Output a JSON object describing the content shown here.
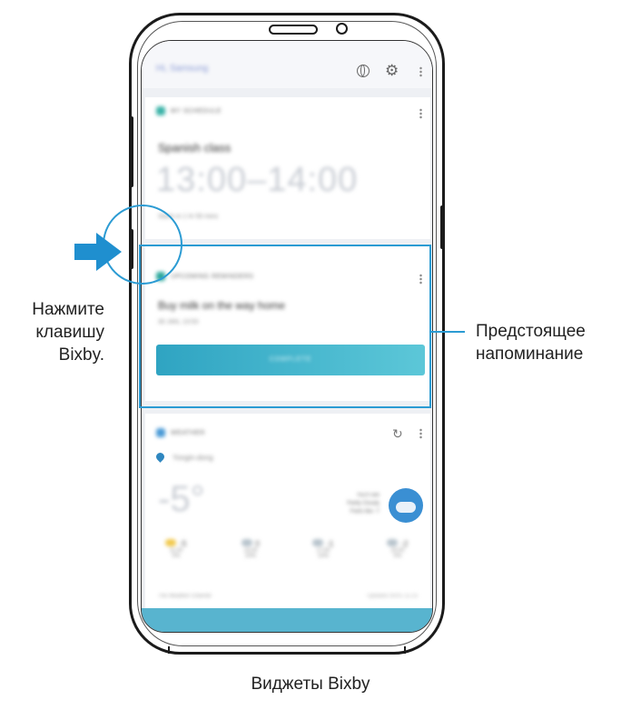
{
  "screen": {
    "topbar_title": "Hi, Samsung",
    "schedule_card": {
      "header": "MY SCHEDULE",
      "title": "Spanish class",
      "time": "13:00–14:00",
      "note": "Starts in 1 hr 50 mins"
    },
    "reminder_card": {
      "header": "UPCOMING REMINDERS",
      "title": "Buy milk on the way home",
      "date": "30 JAN, 13:53",
      "button": "COMPLETE"
    },
    "weather_card": {
      "header": "WEATHER",
      "location": "Yongin-dong",
      "temperature": "-5°",
      "desc_line1": "You'll see",
      "desc_line2": "Partly Cloudy",
      "desc_line3": "Feels like -7",
      "forecast": [
        {
          "temp": "-5",
          "time": "11:00",
          "pct": "0%"
        },
        {
          "temp": "0",
          "time": "14:00",
          "pct": "20%"
        },
        {
          "temp": "-1",
          "time": "17:00",
          "pct": "10%"
        },
        {
          "temp": "-2",
          "time": "20:00",
          "pct": "0%"
        }
      ],
      "footer": "The Weather Channel",
      "updated": "Updated 30/01 11:13"
    }
  },
  "annotations": {
    "left_label": [
      "Нажмите",
      "клавишу",
      "Bixby."
    ],
    "right_label": [
      "Предстоящее",
      "напоминание"
    ],
    "caption": "Виджеты Bixby"
  },
  "colors": {
    "accent": "#2b9bd3",
    "button": "#2fa4c2",
    "arrow": "#1f8fcf"
  },
  "icons": [
    "globe-icon",
    "gear-icon",
    "refresh-icon",
    "location-pin-icon",
    "weather-cloud-icon",
    "arrow-right-icon"
  ]
}
